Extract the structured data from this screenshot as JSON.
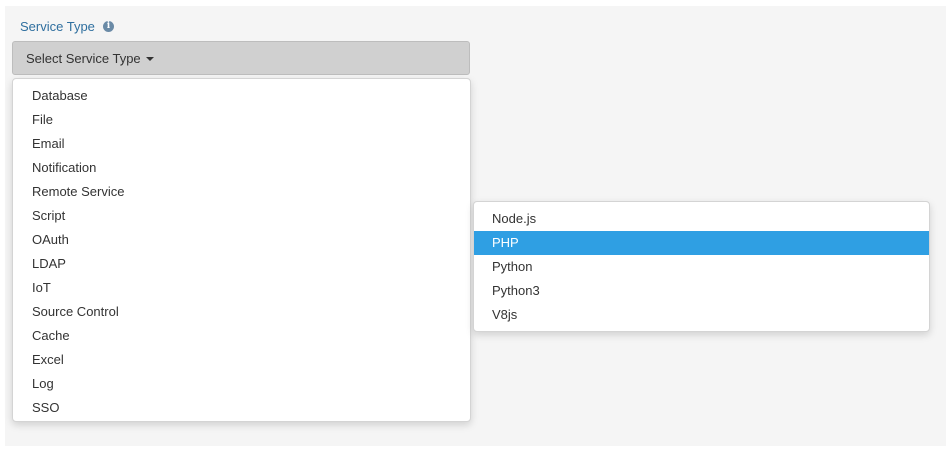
{
  "field": {
    "label": "Service Type",
    "info_icon": "info-circle-icon",
    "info_glyph": "i"
  },
  "select": {
    "label": "Select Service Type",
    "caret_icon": "caret-down-icon"
  },
  "service_types": [
    "Database",
    "File",
    "Email",
    "Notification",
    "Remote Service",
    "Script",
    "OAuth",
    "LDAP",
    "IoT",
    "Source Control",
    "Cache",
    "Excel",
    "Log",
    "SSO"
  ],
  "submenu": {
    "items": [
      "Node.js",
      "PHP",
      "Python",
      "Python3",
      "V8js"
    ],
    "highlighted": "PHP"
  },
  "colors": {
    "label_text": "#2f6f9f",
    "highlight": "#2f9fe3",
    "button_bg": "#d0d0d0",
    "panel_bg": "#f5f5f5"
  }
}
